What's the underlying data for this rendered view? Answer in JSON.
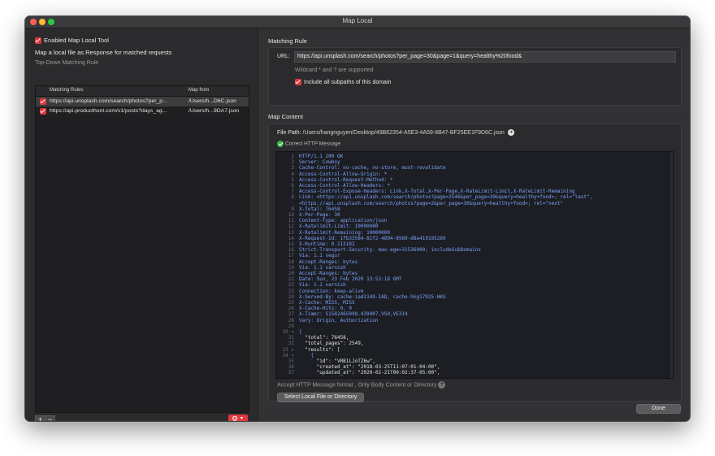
{
  "window": {
    "title": "Map Local"
  },
  "left": {
    "enable_label": "Enabled Map Local Tool",
    "description": "Map a local file as Response for matched requests",
    "section": "Top-Down Matching Rule",
    "table": {
      "headers": [
        "Matching Rules",
        "Map from"
      ],
      "rows": [
        {
          "rule": "https://api.unsplash.com/search/photos?per_p...",
          "from": "/Users/h...D6C.json"
        },
        {
          "rule": "https://api.producthunt.com/v1/posts?days_ag...",
          "from": "/Users/h...9DA7.json"
        }
      ]
    },
    "add_label": "+",
    "remove_label": "−",
    "gear_icon": "gear-icon",
    "accent": "#e0383e"
  },
  "matching": {
    "title": "Matching Rule",
    "url_label": "URL:",
    "url_value": "https://api.unsplash.com/search/photos?per_page=30&page=1&query=healthy%20food&",
    "wildcard_hint": "Wildcard * and ? are supported",
    "subpaths_label": "Include all subpaths of this domain"
  },
  "content": {
    "title": "Map Content",
    "file_path_label": "File Path:",
    "file_path": "/Users/hangnguyen/Desktop/49B62354-A5E3-4A59-8B47-BF25EE1F9D6C.json",
    "status": "Correct HTTP Message",
    "code_lines": [
      "HTTP/1.1 200 OK",
      "Server: Cowboy",
      "Cache-Control: no-cache, no-store, must-revalidate",
      "Access-Control-Allow-Origin: *",
      "Access-Control-Request-Method: *",
      "Access-Control-Allow-Headers: *",
      "Access-Control-Expose-Headers: Link,X-Total,X-Per-Page,X-RateLimit-Limit,X-RateLimit-Remaining",
      "Link: <https://api.unsplash.com/search/photos?page=2546&per_page=30&query=healthy+food>; rel=\"last\",",
      "<https://api.unsplash.com/search/photos?page=2&per_page=30&query=healthy+food>; rel=\"next\"",
      "X-Total: 76458",
      "X-Per-Page: 30",
      "Content-Type: application/json",
      "X-Ratelimit-Limit: 10000000",
      "X-Ratelimit-Remaining: 10000000",
      "X-Request-Id: 1fb33584-81f2-4894-8560-d8e419195269",
      "X-Runtime: 0.113182",
      "Strict-Transport-Security: max-age=31536000; includeSubDomains",
      "Via: 1.1 vegur",
      "Accept-Ranges: bytes",
      "Via: 1.1 varnish",
      "Accept-Ranges: bytes",
      "Date: Sun, 23 Feb 2020 13:53:18 GMT",
      "Via: 1.1 varnish",
      "Connection: keep-alive",
      "X-Served-By: cache-iad2149-IAD, cache-hkg17925-HKG",
      "X-Cache: MISS, MISS",
      "X-Cache-Hits: 0, 0",
      "X-Timer: S1582465998.439407,VS0,VE314",
      "Vary: Origin, Authorization",
      "",
      "{",
      "  \"total\": 76458,",
      "  \"total_pages\": 2549,",
      "  \"results\": [",
      "    {",
      "      \"id\": \"VRB1LJoTZ6w\",",
      "      \"created_at\": \"2018-03-25T11:07:01-04:00\",",
      "      \"updated_at\": \"2020-02-21T00:02:37-05:00\","
    ],
    "line_numbers": [
      "1",
      "2",
      "3",
      "4",
      "5",
      "6",
      "7",
      "8",
      "",
      "9",
      "10",
      "11",
      "12",
      "13",
      "14",
      "15",
      "16",
      "17",
      "18",
      "19",
      "20",
      "21",
      "22",
      "23",
      "24",
      "25",
      "26",
      "27",
      "28",
      "29",
      "30 ▾",
      "31",
      "32",
      "33 ▸",
      "34 ▾",
      "35",
      "36",
      "37"
    ],
    "format_hint": "Accept HTTP Message format , Only Body Content or Directory",
    "select_button": "Select Local File or Directory",
    "done_button": "Done"
  }
}
